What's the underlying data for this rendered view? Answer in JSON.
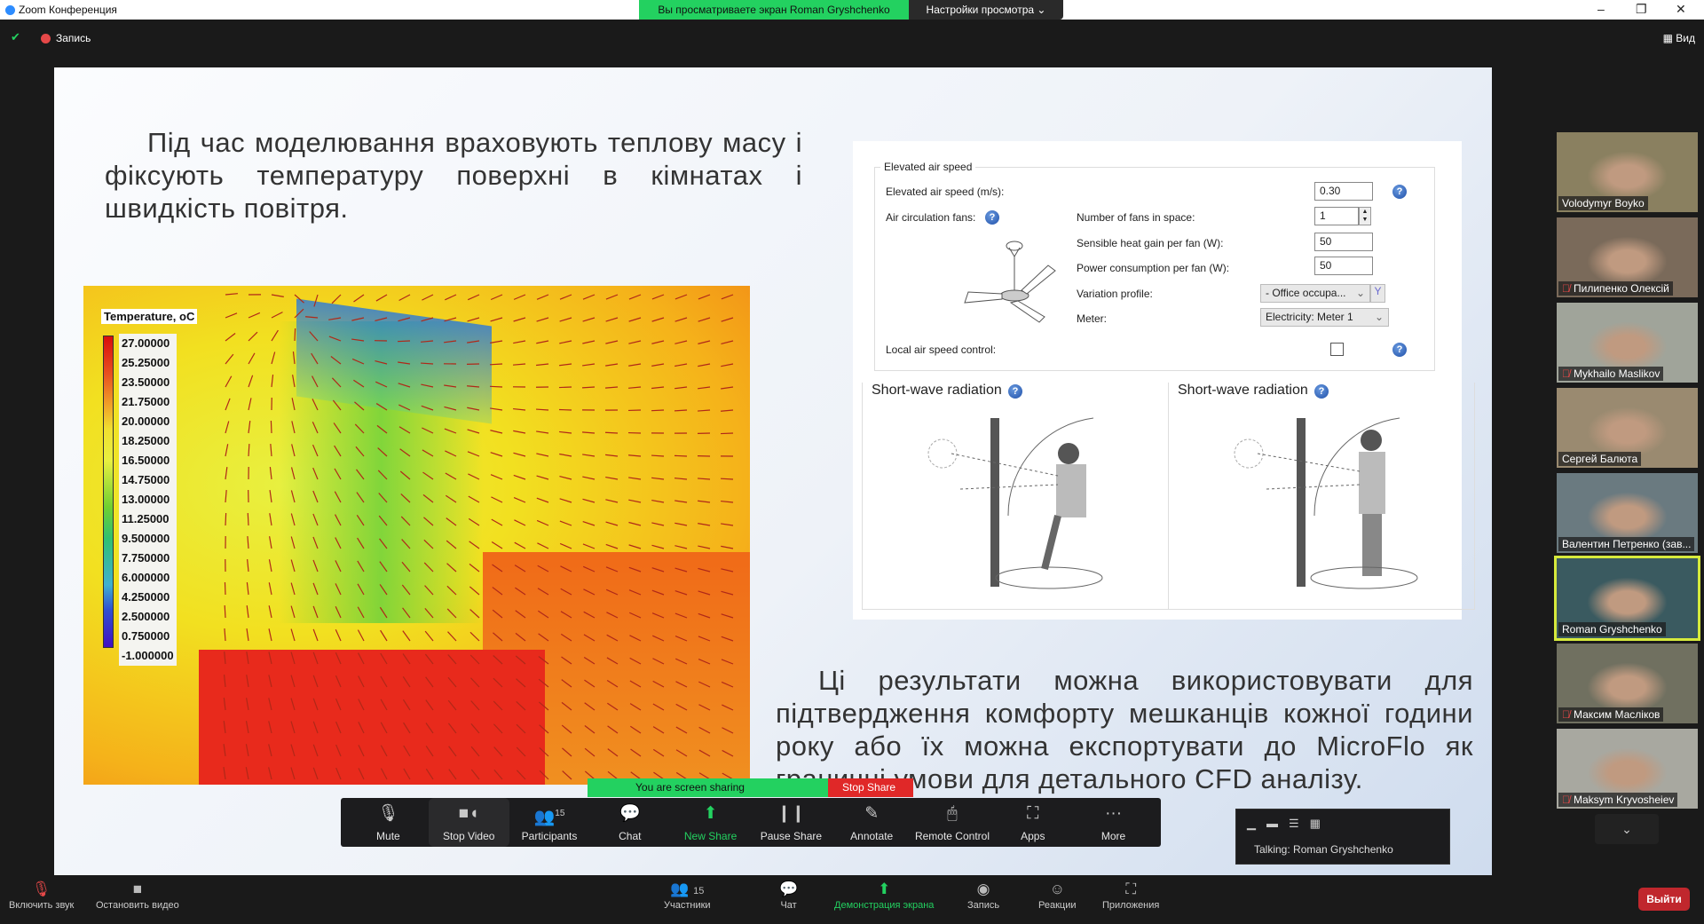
{
  "titlebar": {
    "app": "Zoom Конференция",
    "viewing": "Вы просматриваете экран Roman Gryshchenko",
    "view_options": "Настройки просмотра ⌄",
    "min": "–",
    "max": "❐",
    "close": "✕"
  },
  "topstrip": {
    "record": "Запись",
    "view": "▦ Вид"
  },
  "slide": {
    "paragraph1": "Під час моделювання враховують теплову масу і фіксують температуру поверхні в кімнатах і швидкість повітря.",
    "paragraph2": "Ці результати можна використовувати для підтвердження комфорту мешканців кожної години року або їх можна експортувати до MicroFlo як граничні умови для детального CFD аналізу.",
    "legend": {
      "title": "Temperature, oC",
      "values": [
        "27.00000",
        "25.25000",
        "23.50000",
        "21.75000",
        "20.00000",
        "18.25000",
        "16.50000",
        "14.75000",
        "13.00000",
        "11.25000",
        "9.500000",
        "7.750000",
        "6.000000",
        "4.250000",
        "2.500000",
        "0.750000",
        "-1.000000"
      ]
    },
    "dialog": {
      "group": "Elevated air speed",
      "speed_label": "Elevated air speed (m/s):",
      "speed_value": "0.30",
      "fans_label": "Air circulation fans:",
      "num_fans_label": "Number of fans in space:",
      "num_fans_value": "1",
      "heat_label": "Sensible heat gain per fan (W):",
      "heat_value": "50",
      "power_label": "Power consumption per fan (W):",
      "power_value": "50",
      "profile_label": "Variation profile:",
      "profile_value": "- Office occupa...",
      "meter_label": "Meter:",
      "meter_value": "Electricity: Meter 1",
      "local_label": "Local air speed control:",
      "local_checked": false,
      "swr1": "Short-wave radiation",
      "swr2": "Short-wave radiation"
    }
  },
  "share": {
    "status": "You are screen sharing",
    "stop": "Stop Share"
  },
  "toolbar": [
    {
      "label": "Mute",
      "icon": "🎙"
    },
    {
      "label": "Stop Video",
      "icon": "■◖"
    },
    {
      "label": "Participants",
      "icon": "👥",
      "count": "15"
    },
    {
      "label": "Chat",
      "icon": "💬"
    },
    {
      "label": "New Share",
      "icon": "⬆"
    },
    {
      "label": "Pause Share",
      "icon": "❙❙"
    },
    {
      "label": "Annotate",
      "icon": "✎"
    },
    {
      "label": "Remote Control",
      "icon": "🖱"
    },
    {
      "label": "Apps",
      "icon": "⛶"
    },
    {
      "label": "More",
      "icon": "···"
    }
  ],
  "talking": {
    "text": "Talking: Roman Gryshchenko",
    "icons": "▁▬☰▦"
  },
  "participants": [
    {
      "name": "Volodymyr Boyko",
      "muted": false
    },
    {
      "name": "Пилипенко Олексій",
      "muted": true
    },
    {
      "name": "Mykhailo Maslikov",
      "muted": true
    },
    {
      "name": "Сергей Балюта",
      "muted": false
    },
    {
      "name": "Валентин Петренко (зав...",
      "muted": false
    },
    {
      "name": "Roman Gryshchenko",
      "muted": false,
      "active": true
    },
    {
      "name": "Максим Масліков",
      "muted": true
    },
    {
      "name": "Maksym Kryvosheiev",
      "muted": true
    }
  ],
  "bottombar": [
    {
      "label": "Включить звук",
      "icon": "🎙"
    },
    {
      "label": "Остановить видео",
      "icon": "■"
    },
    {
      "label": "Участники",
      "icon": "👥",
      "count": "15"
    },
    {
      "label": "Чат",
      "icon": "💬"
    },
    {
      "label": "Демонстрация экрана",
      "icon": "⬆"
    },
    {
      "label": "Запись",
      "icon": "◉"
    },
    {
      "label": "Реакции",
      "icon": "☺"
    },
    {
      "label": "Приложения",
      "icon": "⛶"
    }
  ],
  "leave": "Выйти",
  "colors": {
    "accent_green": "#23d160",
    "stop_red": "#e02828",
    "leave_red": "#c0272d",
    "active_speaker": "#d6ea3c"
  }
}
